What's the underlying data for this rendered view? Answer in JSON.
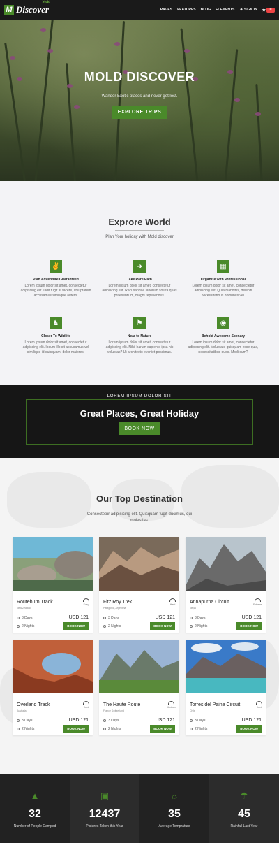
{
  "brand": {
    "name": "Discover",
    "sub": "Mold",
    "mark": "M"
  },
  "nav": {
    "items": [
      "PAGES",
      "FEATURES",
      "BLOG",
      "ELEMENTS"
    ],
    "signin": "SIGN IN",
    "cart_count": "0"
  },
  "hero": {
    "title": "MOLD DISCOVER",
    "subtitle": "Wander Exotic places and never get lost.",
    "button": "EXPLORE TRIPS"
  },
  "explore": {
    "title": "Exprore World",
    "subtitle": "Plan Your holiday with Mold discover",
    "features": [
      {
        "title": "Plan Adventure Guaranteed",
        "text": "Lorem ipsum dolor sit amet, consectetur adipiscing elit. Odit fugit at facere, voluptatem accusamus similique autem.",
        "icon": "hand-icon"
      },
      {
        "title": "Take Rare Path",
        "text": "Lorem ipsum dolor sit amet, consectetur adipiscing elit. Recusandae laborum soluta quas praesentium, magni repellendus.",
        "icon": "signpost-icon"
      },
      {
        "title": "Organize with Professional",
        "text": "Lorem ipsum dolor sit amet, consectetur adipiscing elit. Quia blanditiis, deleniti necessitatibus doloribus vel.",
        "icon": "map-icon"
      },
      {
        "title": "Closer To Wildlife",
        "text": "Lorem ipsum dolor sit amet, consectetur adipiscing elit. Ipsum illo sit accusamus vel similique id quisquam, dolor maiores.",
        "icon": "deer-icon"
      },
      {
        "title": "Near to Nature",
        "text": "Lorem ipsum dolor sit amet, consectetur adipiscing elit. Nihil harum sapiente ipsa hic voluptas? Ut architecto eveniet possimus.",
        "icon": "flag-icon"
      },
      {
        "title": "Behold Awesome Scenary",
        "text": "Lorem ipsum dolor sit amet, consectetur adipiscing elit. Voluptate quisquam esse quia, necessitatibus quos. Modi cum?",
        "icon": "bike-icon"
      }
    ]
  },
  "banner": {
    "kicker": "LOREM IPSUM DOLOR SIT",
    "title": "Great Places, Great Holiday",
    "button": "BOOK NOW"
  },
  "destinations": {
    "title": "Our Top Destination",
    "subtitle": "Consectetur adipisicing elit. Quisquam fugit ducimus, qui molestias.",
    "cards": [
      {
        "name": "Routeburn Track",
        "location": "New Zealand",
        "difficulty": "Easy",
        "days": "3 Days",
        "nights": "2 Nights",
        "price": "USD 121",
        "button": "BOOK NOW"
      },
      {
        "name": "Fitz Roy Trek",
        "location": "Patagonia, Argentina",
        "difficulty": "Hard",
        "days": "3 Days",
        "nights": "2 Nights",
        "price": "USD 121",
        "button": "BOOK NOW"
      },
      {
        "name": "Annapurna Circuit",
        "location": "Nepal",
        "difficulty": "Extreme",
        "days": "3 Days",
        "nights": "2 Nights",
        "price": "USD 121",
        "button": "BOOK NOW"
      },
      {
        "name": "Overland Track",
        "location": "Australia",
        "difficulty": "Hard",
        "days": "3 Days",
        "nights": "2 Nights",
        "price": "USD 121",
        "button": "BOOK NOW"
      },
      {
        "name": "The Haute Route",
        "location": "France Switzerland",
        "difficulty": "Medium",
        "days": "3 Days",
        "nights": "2 Nights",
        "price": "USD 121",
        "button": "BOOK NOW"
      },
      {
        "name": "Torres del Paine Circuit",
        "location": "Chile",
        "difficulty": "Hard",
        "days": "3 Days",
        "nights": "2 Nights",
        "price": "USD 121",
        "button": "BOOK NOW"
      }
    ]
  },
  "stats": [
    {
      "value": "32",
      "label": "Number of People Camped",
      "icon": "tent-icon",
      "bg": "#222222"
    },
    {
      "value": "12437",
      "label": "Pictures Taken this Year",
      "icon": "camera-icon",
      "bg": "#2c2c2c"
    },
    {
      "value": "35",
      "label": "Average Temprature",
      "icon": "sun-icon",
      "bg": "#222222"
    },
    {
      "value": "45",
      "label": "Rainfall Last Year",
      "icon": "umbrella-icon",
      "bg": "#2c2c2c"
    }
  ],
  "colors": {
    "accent": "#4a8a2a",
    "dark": "#161616"
  }
}
